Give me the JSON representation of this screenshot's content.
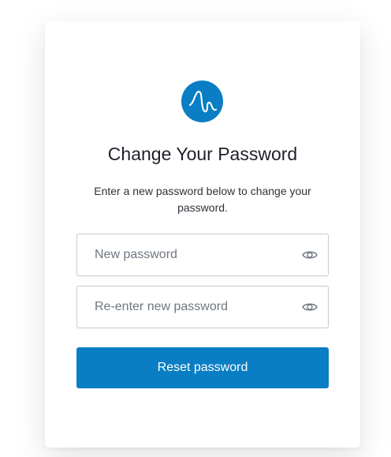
{
  "form": {
    "logo_icon": "wave-logo-icon",
    "title": "Change Your Password",
    "subtitle": "Enter a new password below to change your password.",
    "new_password": {
      "placeholder": "New password",
      "value": "",
      "toggle_icon": "eye-icon"
    },
    "confirm_password": {
      "placeholder": "Re-enter new password",
      "value": "",
      "toggle_icon": "eye-icon"
    },
    "submit_label": "Reset password"
  },
  "colors": {
    "accent": "#0a7ec4",
    "title_text": "#1e212a",
    "placeholder_text": "#6f7780",
    "border": "#c9cace"
  }
}
